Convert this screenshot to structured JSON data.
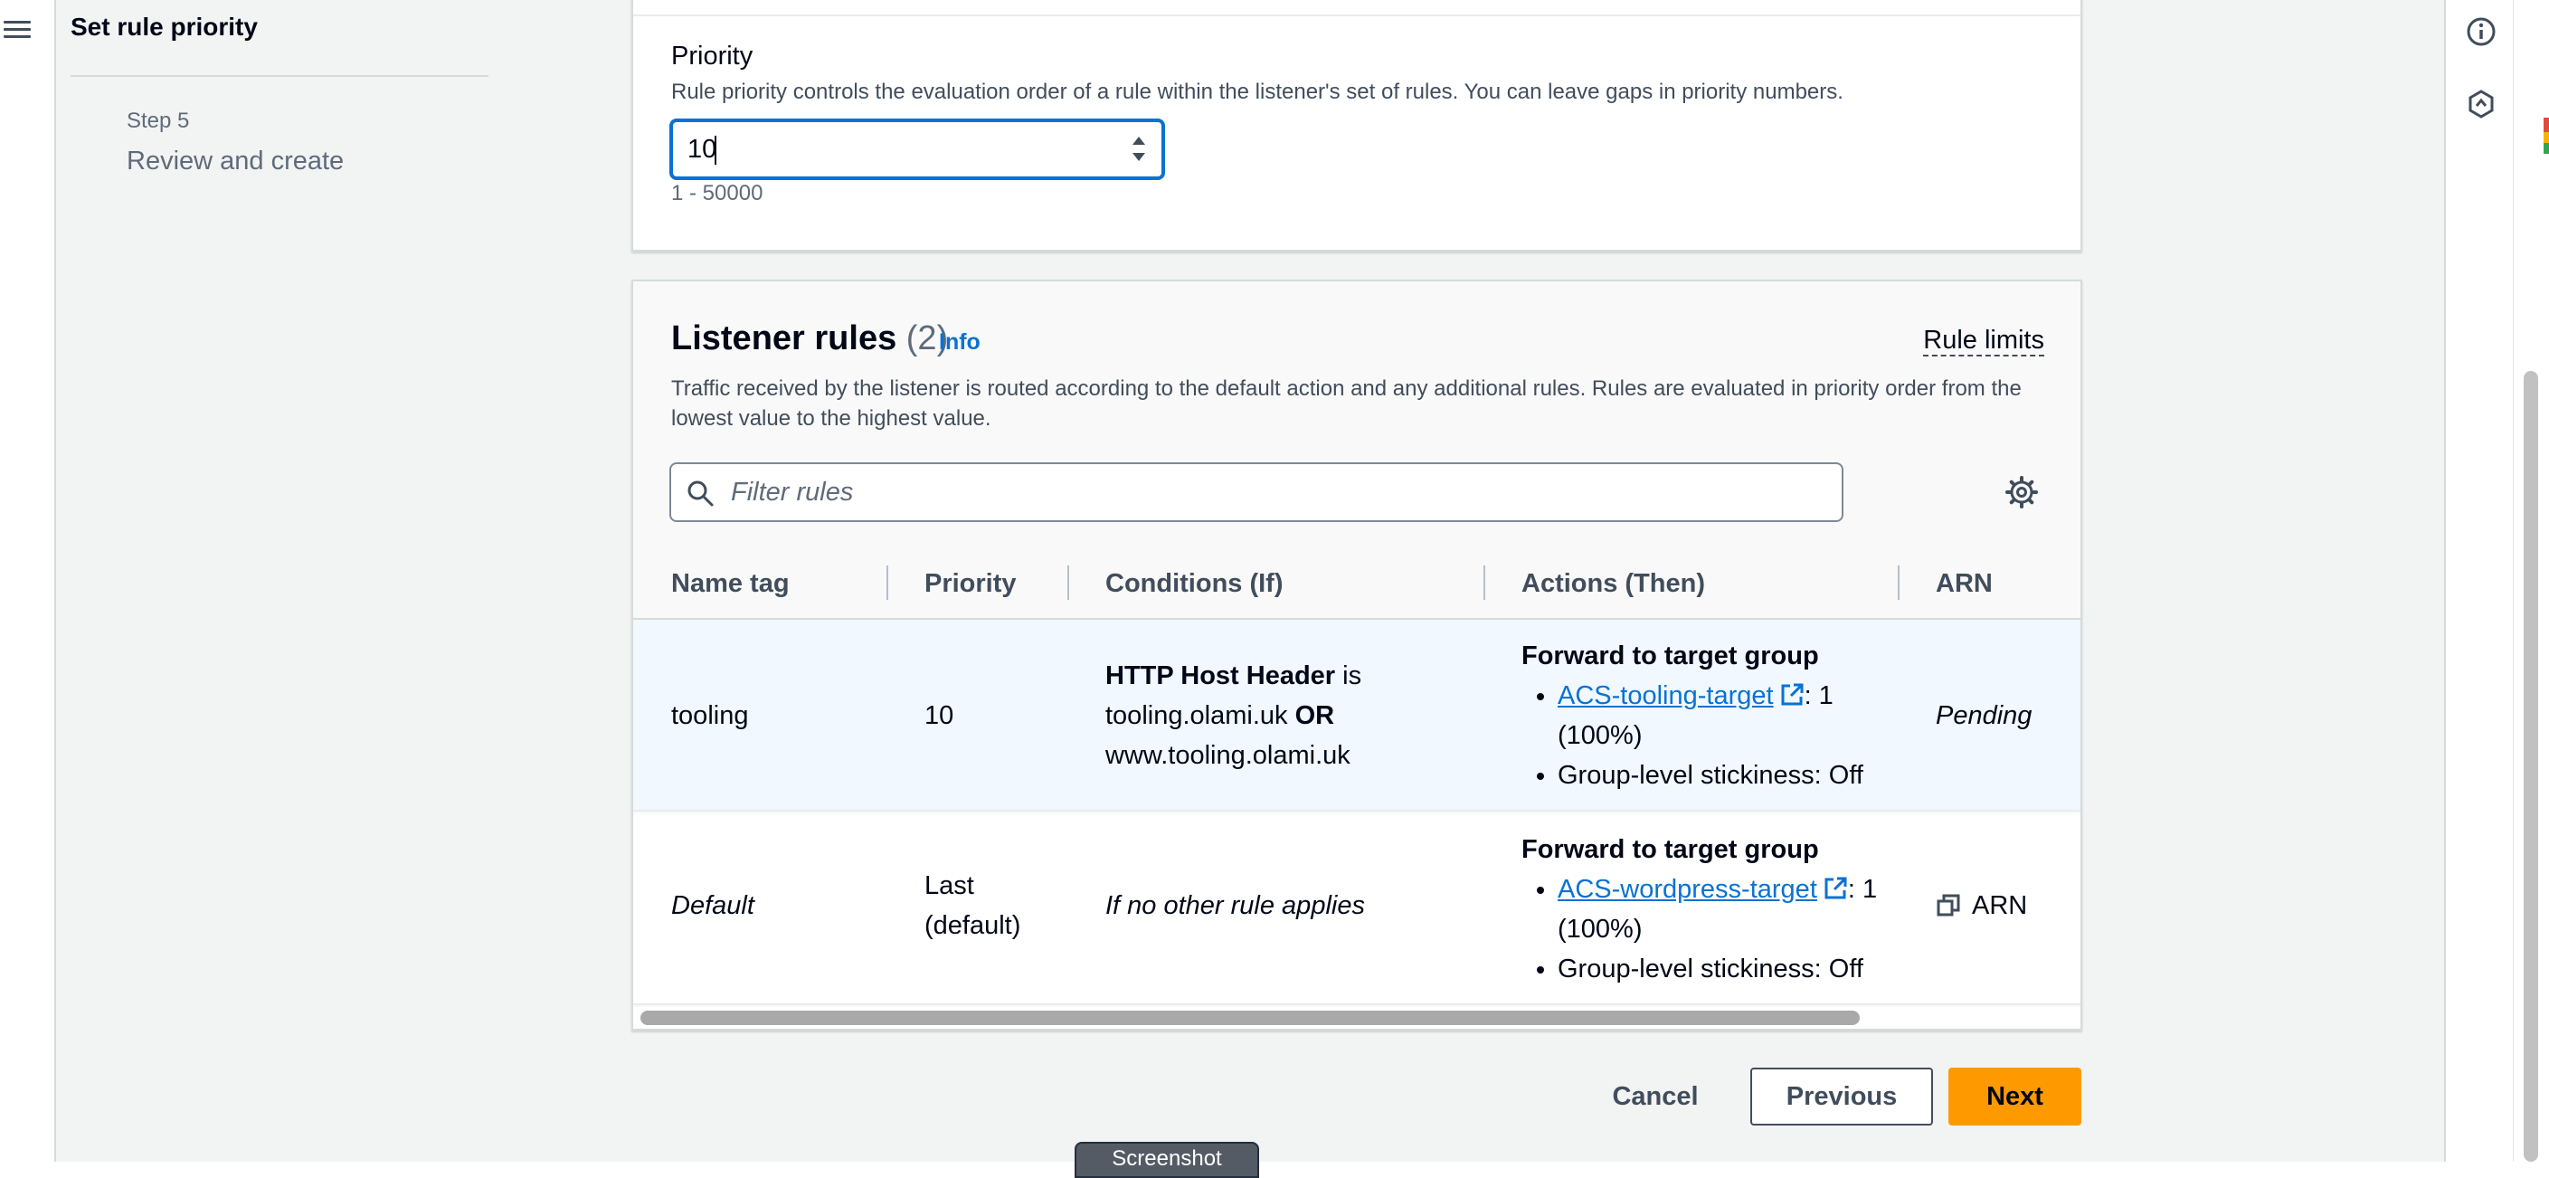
{
  "wizard": {
    "current_step_title": "Set rule priority",
    "next_step_label": "Step 5",
    "next_step_title": "Review and create"
  },
  "priority": {
    "label": "Priority",
    "description": "Rule priority controls the evaluation order of a rule within the listener's set of rules. You can leave gaps in priority numbers.",
    "value": "10",
    "constraint": "1 - 50000"
  },
  "listener_rules": {
    "title": "Listener rules",
    "count": "(2)",
    "info_link": "Info",
    "rule_limits": "Rule limits",
    "description": "Traffic received by the listener is routed according to the default action and any additional rules. Rules are evaluated in priority order from the lowest value to the highest value.",
    "filter_placeholder": "Filter rules",
    "columns": [
      "Name tag",
      "Priority",
      "Conditions (If)",
      "Actions (Then)",
      "ARN"
    ],
    "rows": [
      {
        "name_tag": "tooling",
        "priority": "10",
        "condition_field": "HTTP Host Header",
        "condition_is": "is",
        "condition_value1": "tooling.olami.uk",
        "condition_or": "OR",
        "condition_value2": "www.tooling.olami.uk",
        "action_title": "Forward to target group",
        "target_name": "ACS-tooling-target",
        "target_weight": ": 1 (100%)",
        "stickiness": "Group-level stickiness: Off",
        "arn": "Pending"
      },
      {
        "name_tag": "Default",
        "priority": "Last (default)",
        "condition": "If no other rule applies",
        "action_title": "Forward to target group",
        "target_name": "ACS-wordpress-target",
        "target_weight": ": 1 (100%)",
        "stickiness": "Group-level stickiness: Off",
        "arn": "ARN"
      }
    ]
  },
  "footer": {
    "cancel": "Cancel",
    "previous": "Previous",
    "next": "Next"
  },
  "overlay_tab": "Screenshot",
  "colors": {
    "primary_action": "#ff9900",
    "link": "#0972d3",
    "focus_border": "#0972d3",
    "selected_row": "#f1f8ff"
  },
  "icons": [
    "hamburger-menu-icon",
    "search-icon",
    "gear-icon",
    "external-link-icon",
    "copy-icon",
    "info-icon",
    "hexagon-icon"
  ]
}
